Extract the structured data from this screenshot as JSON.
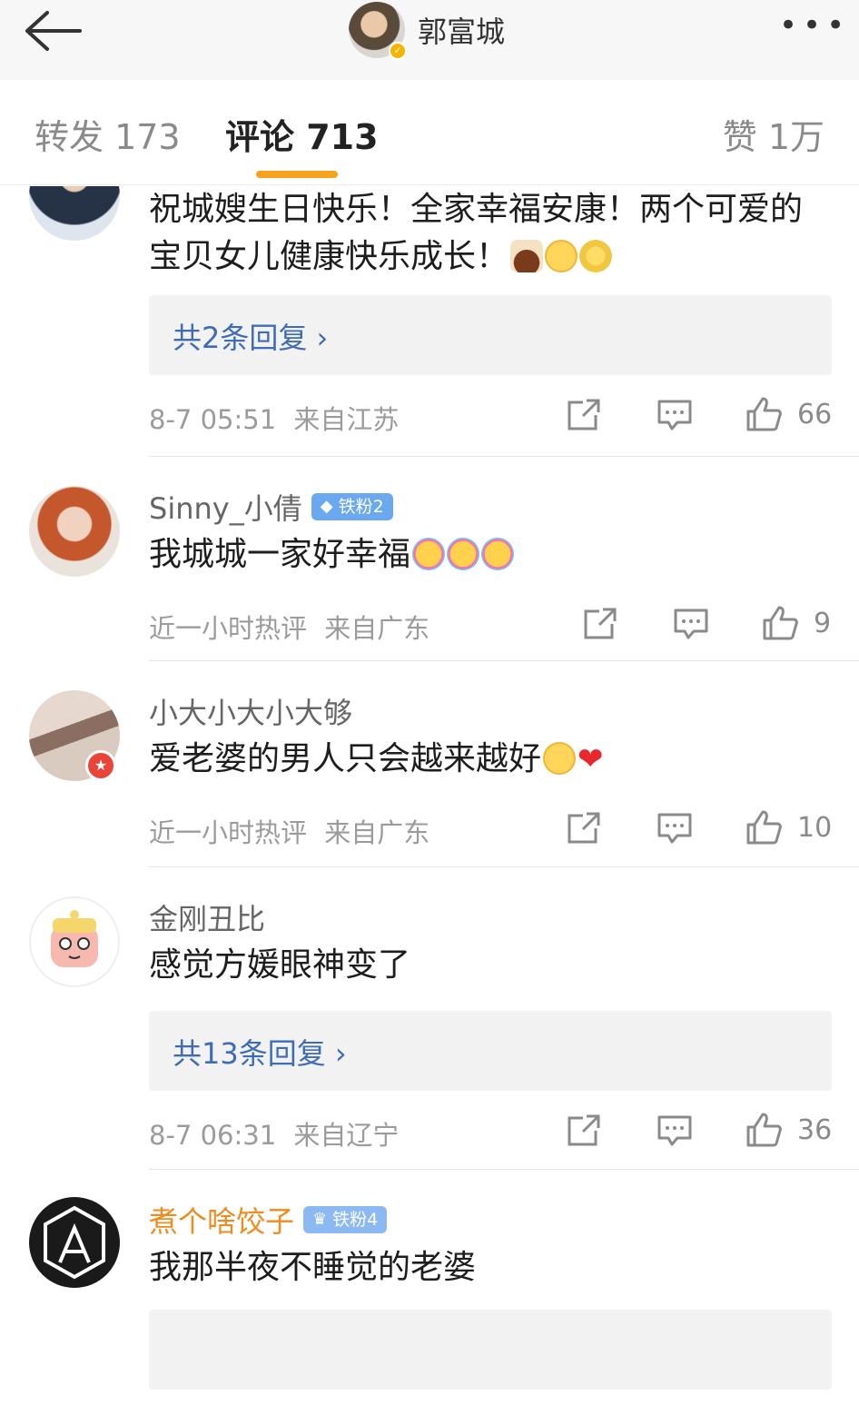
{
  "header": {
    "back_icon": "arrow-left-icon",
    "title": "郭富城",
    "more_icon": "more-dots-icon",
    "more_label": "•••"
  },
  "tabs": [
    {
      "label": "转发 173"
    },
    {
      "label": "评论 713",
      "active": true
    },
    {
      "label": "赞 1万"
    }
  ],
  "colors": {
    "accent": "#f7a21c",
    "link": "#3f6cb6",
    "orange_name": "#f08a1e"
  },
  "comments": [
    {
      "username": "",
      "text": "祝城嫂生日快乐！全家幸福安康！两个可爱的宝贝女儿健康快乐成长！",
      "emojis": [
        "cake-emoji",
        "smile-emoji",
        "flower-emoji"
      ],
      "replies": "共2条回复 ›",
      "time": "8-7 05:51",
      "location": "来自江苏",
      "likes": "66"
    },
    {
      "username": "Sinny_小倩",
      "badge": "铁粉2",
      "text": "我城城一家好幸福",
      "emojis": [
        "kiss-emoji",
        "kiss-emoji",
        "kiss-emoji"
      ],
      "time": "近一小时热评",
      "location": "来自广东",
      "likes": "9"
    },
    {
      "username": "小大小大小大够",
      "text": "爱老婆的男人只会越来越好",
      "emojis": [
        "hug-emoji",
        "heart-emoji"
      ],
      "heart": "❤",
      "time": "近一小时热评",
      "location": "来自广东",
      "likes": "10"
    },
    {
      "username": "金刚丑比",
      "text": "感觉方媛眼神变了",
      "replies": "共13条回复 ›",
      "time": "8-7 06:31",
      "location": "来自辽宁",
      "likes": "36"
    },
    {
      "username": "煮个啥饺子",
      "badge": "铁粉4",
      "text": "我那半夜不睡觉的老婆"
    }
  ]
}
